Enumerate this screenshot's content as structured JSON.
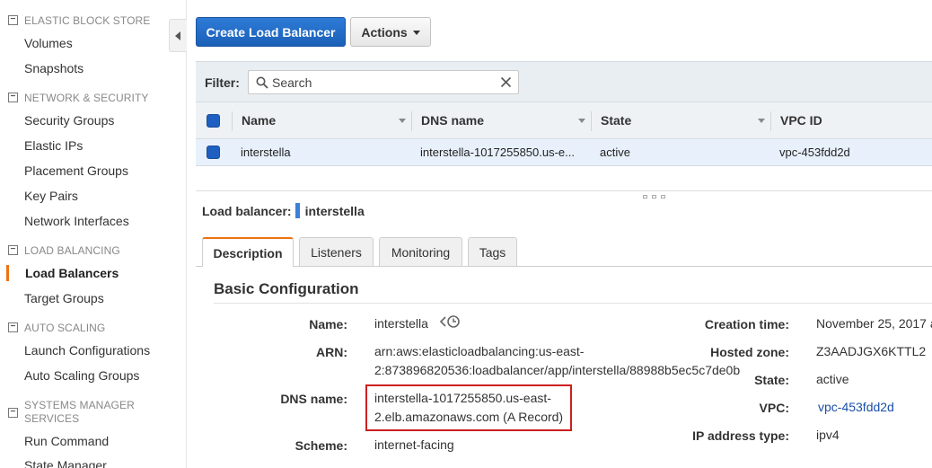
{
  "sidebar": {
    "sections": [
      {
        "title": "ELASTIC BLOCK STORE",
        "items": [
          "Volumes",
          "Snapshots"
        ]
      },
      {
        "title": "NETWORK & SECURITY",
        "items": [
          "Security Groups",
          "Elastic IPs",
          "Placement Groups",
          "Key Pairs",
          "Network Interfaces"
        ]
      },
      {
        "title": "LOAD BALANCING",
        "items": [
          "Load Balancers",
          "Target Groups"
        ]
      },
      {
        "title": "AUTO SCALING",
        "items": [
          "Launch Configurations",
          "Auto Scaling Groups"
        ]
      },
      {
        "title_line1": "SYSTEMS MANAGER",
        "title_line2": "SERVICES",
        "items": [
          "Run Command",
          "State Manager"
        ]
      }
    ],
    "active_item": "Load Balancers"
  },
  "toolbar": {
    "create_label": "Create Load Balancer",
    "actions_label": "Actions"
  },
  "filter": {
    "label": "Filter:",
    "placeholder": "Search"
  },
  "table": {
    "headers": [
      "Name",
      "DNS name",
      "State",
      "VPC ID"
    ],
    "rows": [
      {
        "name": "interstella",
        "dns": "interstella-1017255850.us-e...",
        "state": "active",
        "vpc": "vpc-453fdd2d"
      }
    ]
  },
  "details": {
    "lb_label": "Load balancer:",
    "lb_name": "interstella",
    "tabs": [
      "Description",
      "Listeners",
      "Monitoring",
      "Tags"
    ],
    "active_tab": "Description",
    "section_title": "Basic Configuration",
    "left": {
      "name_key": "Name:",
      "name_val": "interstella",
      "arn_key": "ARN:",
      "arn_line1": "arn:aws:elasticloadbalancing:us-east-",
      "arn_line2": "2:873896820536:loadbalancer/app/interstella/88988b5ec5c7de0b",
      "dns_key": "DNS name:",
      "dns_line1": "interstella-1017255850.us-east-",
      "dns_line2": "2.elb.amazonaws.com (A Record)",
      "scheme_key": "Scheme:",
      "scheme_val": "internet-facing"
    },
    "right": {
      "created_key": "Creation time:",
      "created_val": "November 25, 2017 a",
      "zone_key": "Hosted zone:",
      "zone_val": "Z3AADJGX6KTTL2",
      "state_key": "State:",
      "state_val": "active",
      "vpc_key": "VPC:",
      "vpc_val": "vpc-453fdd2d",
      "ipt_key": "IP address type:",
      "ipt_val": "ipv4"
    }
  },
  "colors": {
    "primary_button": "#1a60b8",
    "active_accent": "#ec7211",
    "highlight_box": "#cc1f1f",
    "link": "#1a4fa8"
  }
}
